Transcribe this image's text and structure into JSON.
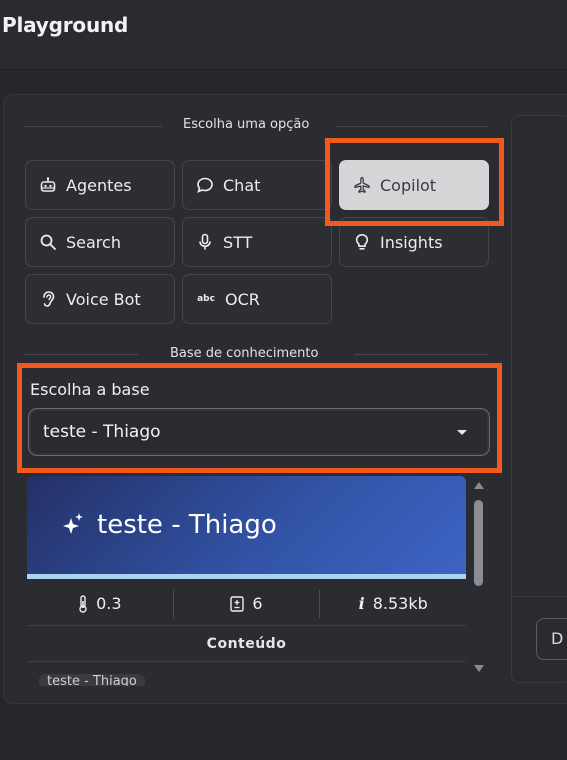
{
  "app": {
    "title": "Playground"
  },
  "options_section": {
    "label": "Escolha uma opção",
    "items": [
      {
        "id": "agentes",
        "label": "Agentes",
        "icon": "robot-icon",
        "selected": false
      },
      {
        "id": "chat",
        "label": "Chat",
        "icon": "chat-bubble-icon",
        "selected": false
      },
      {
        "id": "copilot",
        "label": "Copilot",
        "icon": "airplane-icon",
        "selected": true
      },
      {
        "id": "search",
        "label": "Search",
        "icon": "search-icon",
        "selected": false
      },
      {
        "id": "stt",
        "label": "STT",
        "icon": "microphone-icon",
        "selected": false
      },
      {
        "id": "insights",
        "label": "Insights",
        "icon": "lightbulb-icon",
        "selected": false
      },
      {
        "id": "voicebot",
        "label": "Voice Bot",
        "icon": "ear-icon",
        "selected": false
      },
      {
        "id": "ocr",
        "label": "OCR",
        "icon": "abc-icon",
        "selected": false
      }
    ]
  },
  "knowledge_section": {
    "label": "Base de conhecimento",
    "field_label": "Escolha a base",
    "selected_value": "teste - Thiago"
  },
  "kb_card": {
    "title": "teste - Thiago",
    "temperature": "0.3",
    "count": "6",
    "size": "8.53kb",
    "content_header": "Conteúdo",
    "content_preview": "teste - Thiago"
  },
  "right_panel": {
    "button_label": "D"
  },
  "colors": {
    "highlight": "#f25a1d",
    "selected_button": "#d6d6d8",
    "banner_accent": "#a9d3f0",
    "banner_gradient_start": "#243066",
    "banner_gradient_end": "#3e63c4"
  }
}
